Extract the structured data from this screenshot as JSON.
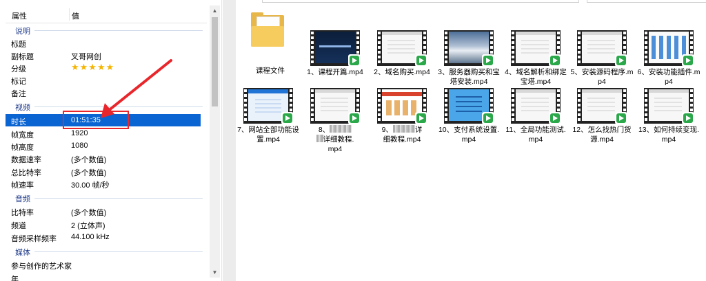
{
  "properties": {
    "header": {
      "col_name": "属性",
      "col_value": "值"
    },
    "groups": {
      "description": "说明",
      "video": "视频",
      "audio": "音频",
      "media": "媒体"
    },
    "description_rows": [
      {
        "key": "标题",
        "value": ""
      },
      {
        "key": "副标题",
        "value": "叉哥网创"
      },
      {
        "key": "分级",
        "value": "★★★★★"
      },
      {
        "key": "标记",
        "value": ""
      },
      {
        "key": "备注",
        "value": ""
      }
    ],
    "video_rows": [
      {
        "key": "时长",
        "value": "01:51:35"
      },
      {
        "key": "帧宽度",
        "value": "1920"
      },
      {
        "key": "帧高度",
        "value": "1080"
      },
      {
        "key": "数据速率",
        "value": "(多个数值)"
      },
      {
        "key": "总比特率",
        "value": "(多个数值)"
      },
      {
        "key": "帧速率",
        "value": "30.00 帧/秒"
      }
    ],
    "audio_rows": [
      {
        "key": "比特率",
        "value": "(多个数值)"
      },
      {
        "key": "频道",
        "value": "2 (立体声)"
      },
      {
        "key": "音频采样频率",
        "value": "44.100 kHz"
      }
    ],
    "media_rows": [
      {
        "key": "参与创作的艺术家",
        "value": ""
      },
      {
        "key": "年",
        "value": ""
      }
    ],
    "highlight_color": "#e8262b",
    "selection_color": "#0a64d2",
    "star_color": "#f4b400"
  },
  "files": [
    {
      "name": "课程文件",
      "icon": "folder-icon"
    },
    {
      "name": "1、课程开篇.mp4",
      "icon": "video-thumbnail"
    },
    {
      "name": "2、域名购买.mp4",
      "icon": "video-thumbnail"
    },
    {
      "name": "3、服务器购买和宝塔安装.mp4",
      "icon": "video-thumbnail"
    },
    {
      "name": "4、域名解析和绑定宝塔.mp4",
      "icon": "video-thumbnail"
    },
    {
      "name": "5、安装源码程序.mp4",
      "icon": "video-thumbnail"
    },
    {
      "name": "6、安装功能插件.mp4",
      "icon": "video-thumbnail"
    },
    {
      "name": "7、网站全部功能设置.mp4",
      "icon": "video-thumbnail"
    },
    {
      "name_prefix": "8、",
      "name_suffix": "详细教程.",
      "name_line2": "mp4",
      "icon": "video-thumbnail"
    },
    {
      "name_prefix": "9、",
      "name_suffix": "详",
      "name_line2": "细教程.mp4",
      "icon": "video-thumbnail"
    },
    {
      "name": "10、支付系统设置.mp4",
      "icon": "video-thumbnail"
    },
    {
      "name": "11、全局功能测试.mp4",
      "icon": "video-thumbnail"
    },
    {
      "name": "12、怎么找热门货源.mp4",
      "icon": "video-thumbnail"
    },
    {
      "name": "13、如何持续变现.mp4",
      "icon": "video-thumbnail"
    }
  ],
  "file_badge_color": "#2aa84a",
  "folder_color": "#e8b74a"
}
